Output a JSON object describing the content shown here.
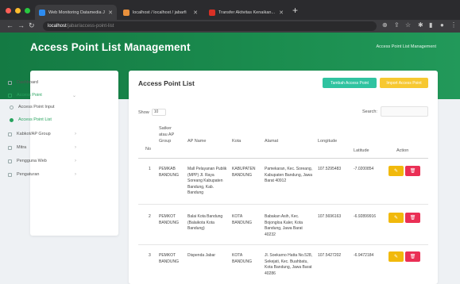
{
  "browser": {
    "tabs": [
      {
        "title": "Web Monitoring Datamedia Jabar"
      },
      {
        "title": "localhost / localhost / jabarfi"
      },
      {
        "title": "Transfer Aktivitas Kenaikan..."
      }
    ],
    "url_host": "localhost",
    "url_path": "/jabar/access-point-list"
  },
  "header": {
    "title": "Access Point List Management",
    "breadcrumb": "Access Point List Management"
  },
  "sidebar": {
    "items": [
      {
        "label": "Dashboard"
      },
      {
        "label": "Access Point"
      },
      {
        "label": "Access Point Input"
      },
      {
        "label": "Access Point List"
      },
      {
        "label": "Kabkot/AP Group"
      },
      {
        "label": "Mitra"
      },
      {
        "label": "Pengguna Web"
      },
      {
        "label": "Pengaturan"
      }
    ]
  },
  "card": {
    "title": "Access Point List",
    "btn_add": "Tambah Access Point",
    "btn_import": "Import Access Point",
    "show_label": "Show",
    "show_value": "10",
    "search_label": "Search:"
  },
  "table": {
    "headers": [
      "No",
      "Satker atau AP Group",
      "AP Name",
      "Kota",
      "Alamat",
      "Longitude",
      "Latitude",
      "Action"
    ],
    "rows": [
      {
        "no": "1",
        "group": "PEMKAB BANDUNG",
        "ap_name": "Mall Pelayanan Publik (MPP) Jl. Raya Soreang Kabupaten Bandung, Kab. Bandung",
        "kota": "KABUPATEN BANDUNG",
        "alamat": "Pamekaran, Kec. Soreang, Kabupaten Bandung, Jawa Barat 40912",
        "longitude": "107.5295483",
        "latitude": "-7.0200854"
      },
      {
        "no": "2",
        "group": "PEMKOT BANDUNG",
        "ap_name": "Balai Kota Bandung (Balaikota Kota Bandung)",
        "kota": "KOTA BANDUNG",
        "alamat": "Babakan Asih, Kec. Bojongloa Kaler, Kota Bandung, Jawa Barat 40232",
        "longitude": "107.5696163",
        "latitude": "-6.92899916"
      },
      {
        "no": "3",
        "group": "PEMKOT BANDUNG",
        "ap_name": "Dispenda Jabar",
        "kota": "KOTA BANDUNG",
        "alamat": "Jl. Soekarno Hatta No.528, Sekejati, Kec. Buahbatu, Kota Bandung, Jawa Barat 40286",
        "longitude": "107.5427202",
        "latitude": "-6.9472184"
      }
    ]
  },
  "colors": {
    "brand_green": "#1b8d4f",
    "button_teal": "#2fc3a0",
    "button_yellow": "#f7c831",
    "edit": "#f1b90c",
    "delete": "#ea2f55"
  }
}
